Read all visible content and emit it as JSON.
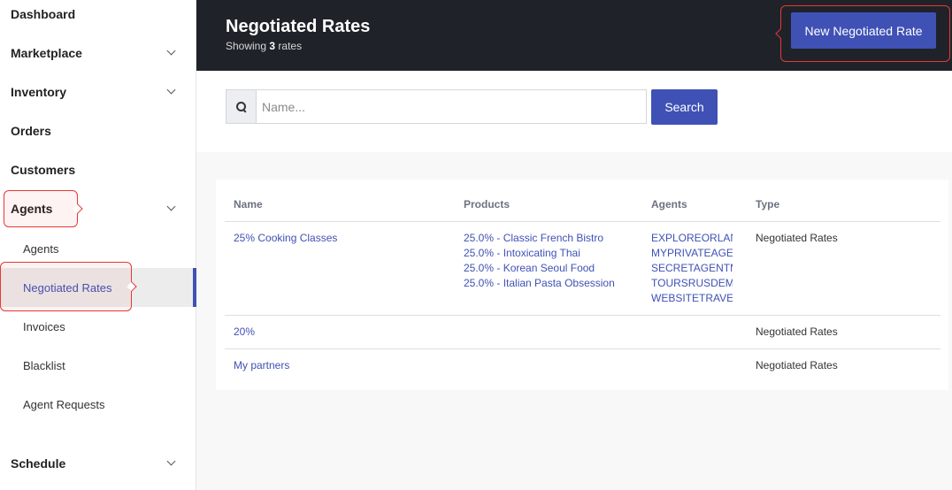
{
  "sidebar": {
    "dashboard": "Dashboard",
    "marketplace": "Marketplace",
    "inventory": "Inventory",
    "orders": "Orders",
    "customers": "Customers",
    "agents": "Agents",
    "sub_items": [
      "Agents",
      "Negotiated Rates",
      "Invoices",
      "Blacklist",
      "Agent Requests"
    ],
    "schedule": "Schedule"
  },
  "header": {
    "title": "Negotiated Rates",
    "subtitle_prefix": "Showing",
    "count": "3",
    "subtitle_suffix": "rates",
    "new_button": "New Negotiated Rate"
  },
  "search": {
    "placeholder": "Name...",
    "value": "",
    "button": "Search"
  },
  "table": {
    "headers": [
      "Name",
      "Products",
      "Agents",
      "Type"
    ],
    "rows": [
      {
        "name": "25% Cooking Classes",
        "products": [
          "25.0% - Classic French Bistro",
          "25.0% - Intoxicating Thai",
          "25.0% - Korean Seoul Food",
          "25.0% - Italian Pasta Obsession"
        ],
        "agents": [
          "EXPLOREORLANI",
          "MYPRIVATEAGEN",
          "SECRETAGENTM",
          "TOURSRUSDEMC",
          "WEBSITETRAVEL"
        ],
        "type": "Negotiated Rates"
      },
      {
        "name": "20%",
        "products": [],
        "agents": [],
        "type": "Negotiated Rates"
      },
      {
        "name": "My partners",
        "products": [],
        "agents": [],
        "type": "Negotiated Rates"
      }
    ]
  },
  "colors": {
    "accent": "#3f51b5",
    "header_bg": "#1f2329",
    "highlight": "#e53935"
  }
}
